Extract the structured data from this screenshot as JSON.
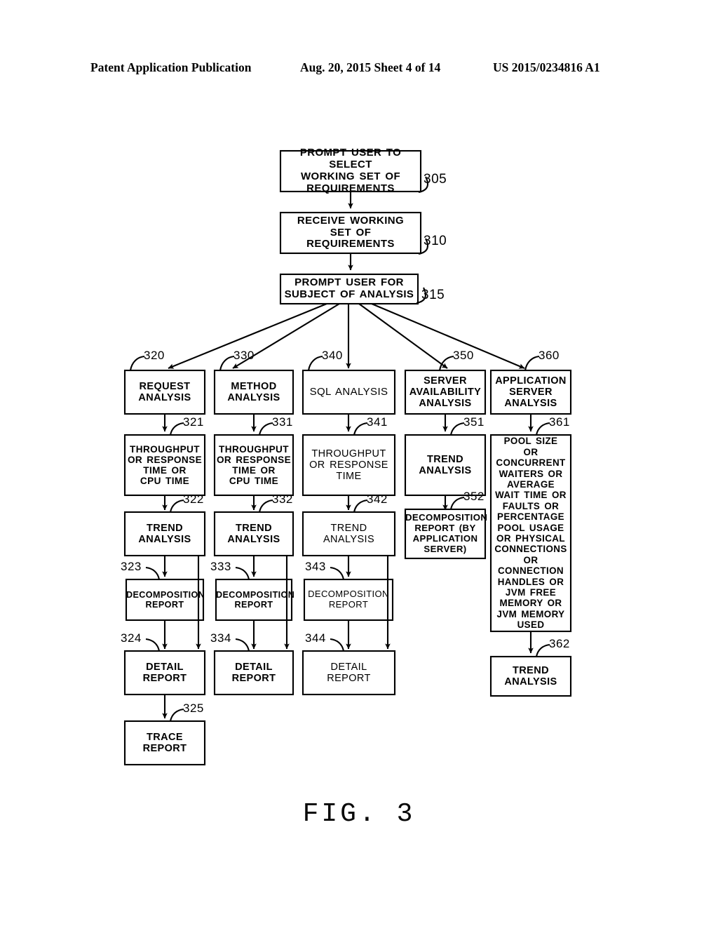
{
  "header": {
    "publication": "Patent Application Publication",
    "date_sheet": "Aug. 20, 2015  Sheet 4 of 14",
    "patent_number": "US 2015/0234816 A1"
  },
  "figure": {
    "caption": "FIG. 3"
  },
  "diagram": {
    "type": "flowchart",
    "nodes": [
      {
        "ref": "305",
        "text": "PROMPT USER TO SELECT WORKING SET OF REQUIREMENTS"
      },
      {
        "ref": "310",
        "text": "RECEIVE WORKING SET OF REQUIREMENTS"
      },
      {
        "ref": "315",
        "text": "PROMPT USER FOR SUBJECT OF ANALYSIS"
      },
      {
        "ref": "320",
        "text": "REQUEST ANALYSIS"
      },
      {
        "ref": "330",
        "text": "METHOD ANALYSIS"
      },
      {
        "ref": "340",
        "text": "SQL ANALYSIS"
      },
      {
        "ref": "350",
        "text": "SERVER AVAILABILITY ANALYSIS"
      },
      {
        "ref": "360",
        "text": "APPLICATION SERVER ANALYSIS"
      },
      {
        "ref": "321",
        "text": "THROUGHPUT OR RESPONSE TIME OR CPU TIME"
      },
      {
        "ref": "331",
        "text": "THROUGHPUT OR RESPONSE TIME OR CPU TIME"
      },
      {
        "ref": "341",
        "text": "THROUGHPUT OR RESPONSE TIME"
      },
      {
        "ref": "351",
        "text": "TREND ANALYSIS"
      },
      {
        "ref": "361",
        "text": "POOL SIZE OR CONCURRENT WAITERS OR AVERAGE WAIT TIME OR FAULTS OR PERCENTAGE POOL USAGE OR PHYSICAL CONNECTIONS OR CONNECTION HANDLES OR JVM FREE MEMORY OR JVM MEMORY USED"
      },
      {
        "ref": "322",
        "text": "TREND ANALYSIS"
      },
      {
        "ref": "332",
        "text": "TREND ANALYSIS"
      },
      {
        "ref": "342",
        "text": "TREND ANALYSIS"
      },
      {
        "ref": "352",
        "text": "DECOMPOSITION REPORT (BY APPLICATION SERVER)"
      },
      {
        "ref": "362",
        "text": "TREND ANALYSIS"
      },
      {
        "ref": "323",
        "text": "DECOMPOSITION REPORT"
      },
      {
        "ref": "333",
        "text": "DECOMPOSITION REPORT"
      },
      {
        "ref": "343",
        "text": "DECOMPOSITION REPORT"
      },
      {
        "ref": "324",
        "text": "DETAIL REPORT"
      },
      {
        "ref": "334",
        "text": "DETAIL REPORT"
      },
      {
        "ref": "344",
        "text": "DETAIL REPORT"
      },
      {
        "ref": "325",
        "text": "TRACE REPORT"
      }
    ]
  },
  "boxes": {
    "b305": {
      "l1": "PROMPT USER TO SELECT",
      "l2": "WORKING SET OF",
      "l3": "REQUIREMENTS",
      "ref": "305"
    },
    "b310": {
      "l1": "RECEIVE  WORKING",
      "l2": "SET OF",
      "l3": "REQUIREMENTS",
      "ref": "310"
    },
    "b315": {
      "l1": "PROMPT  USER  FOR",
      "l2": "SUBJECT OF ANALYSIS",
      "ref": "315"
    },
    "b320": {
      "l1": "REQUEST",
      "l2": "ANALYSIS",
      "ref": "320"
    },
    "b330": {
      "l1": "METHOD",
      "l2": "ANALYSIS",
      "ref": "330"
    },
    "b340": {
      "l1": "SQL  ANALYSIS",
      "ref": "340"
    },
    "b350": {
      "l1": "SERVER",
      "l2": "AVAILABILITY",
      "l3": "ANALYSIS",
      "ref": "350"
    },
    "b360": {
      "l1": "APPLICATION",
      "l2": "SERVER",
      "l3": "ANALYSIS",
      "ref": "360"
    },
    "b321": {
      "l1": "THROUGHPUT",
      "l2": "OR RESPONSE",
      "l3": "TIME OR",
      "l4": "CPU TIME",
      "ref": "321"
    },
    "b331": {
      "l1": "THROUGHPUT",
      "l2": "OR RESPONSE",
      "l3": "TIME OR",
      "l4": "CPU TIME",
      "ref": "331"
    },
    "b341": {
      "l1": "THROUGHPUT",
      "l2": "OR RESPONSE",
      "l3": "TIME",
      "ref": "341"
    },
    "b351": {
      "l1": "TREND",
      "l2": "ANALYSIS",
      "ref": "351"
    },
    "b361": {
      "l1": "POOL SIZE",
      "l2": "OR",
      "l3": "CONCURRENT",
      "l4": "WAITERS OR",
      "l5": "AVERAGE",
      "l6": "WAIT TIME OR",
      "l7": "FAULTS OR",
      "l8": "PERCENTAGE",
      "l9": "POOL USAGE",
      "l10": "OR PHYSICAL",
      "l11": "CONNECTIONS",
      "l12": "OR",
      "l13": "CONNECTION",
      "l14": "HANDLES OR",
      "l15": "JVM FREE",
      "l16": "MEMORY OR",
      "l17": "JVM MEMORY",
      "l18": "USED",
      "ref": "361"
    },
    "b322": {
      "l1": "TREND",
      "l2": "ANALYSIS",
      "ref": "322"
    },
    "b332": {
      "l1": "TREND",
      "l2": "ANALYSIS",
      "ref": "332"
    },
    "b342": {
      "l1": "TREND",
      "l2": "ANALYSIS",
      "ref": "342"
    },
    "b352": {
      "l1": "DECOMPOSITION",
      "l2": "REPORT (BY",
      "l3": "APPLICATION",
      "l4": "SERVER)",
      "ref": "352"
    },
    "b362": {
      "l1": "TREND",
      "l2": "ANALYSIS",
      "ref": "362"
    },
    "b323": {
      "l1": "DECOMPOSITION",
      "l2": "REPORT",
      "ref": "323"
    },
    "b333": {
      "l1": "DECOMPOSITION",
      "l2": "REPORT",
      "ref": "333"
    },
    "b343": {
      "l1": "DECOMPOSITION",
      "l2": "REPORT",
      "ref": "343"
    },
    "b324": {
      "l1": "DETAIL",
      "l2": "REPORT",
      "ref": "324"
    },
    "b334": {
      "l1": "DETAIL",
      "l2": "REPORT",
      "ref": "334"
    },
    "b344": {
      "l1": "DETAIL",
      "l2": "REPORT",
      "ref": "344"
    },
    "b325": {
      "l1": "TRACE",
      "l2": "REPORT",
      "ref": "325"
    }
  },
  "colors": {
    "ink": "#000000",
    "paper": "#ffffff"
  }
}
